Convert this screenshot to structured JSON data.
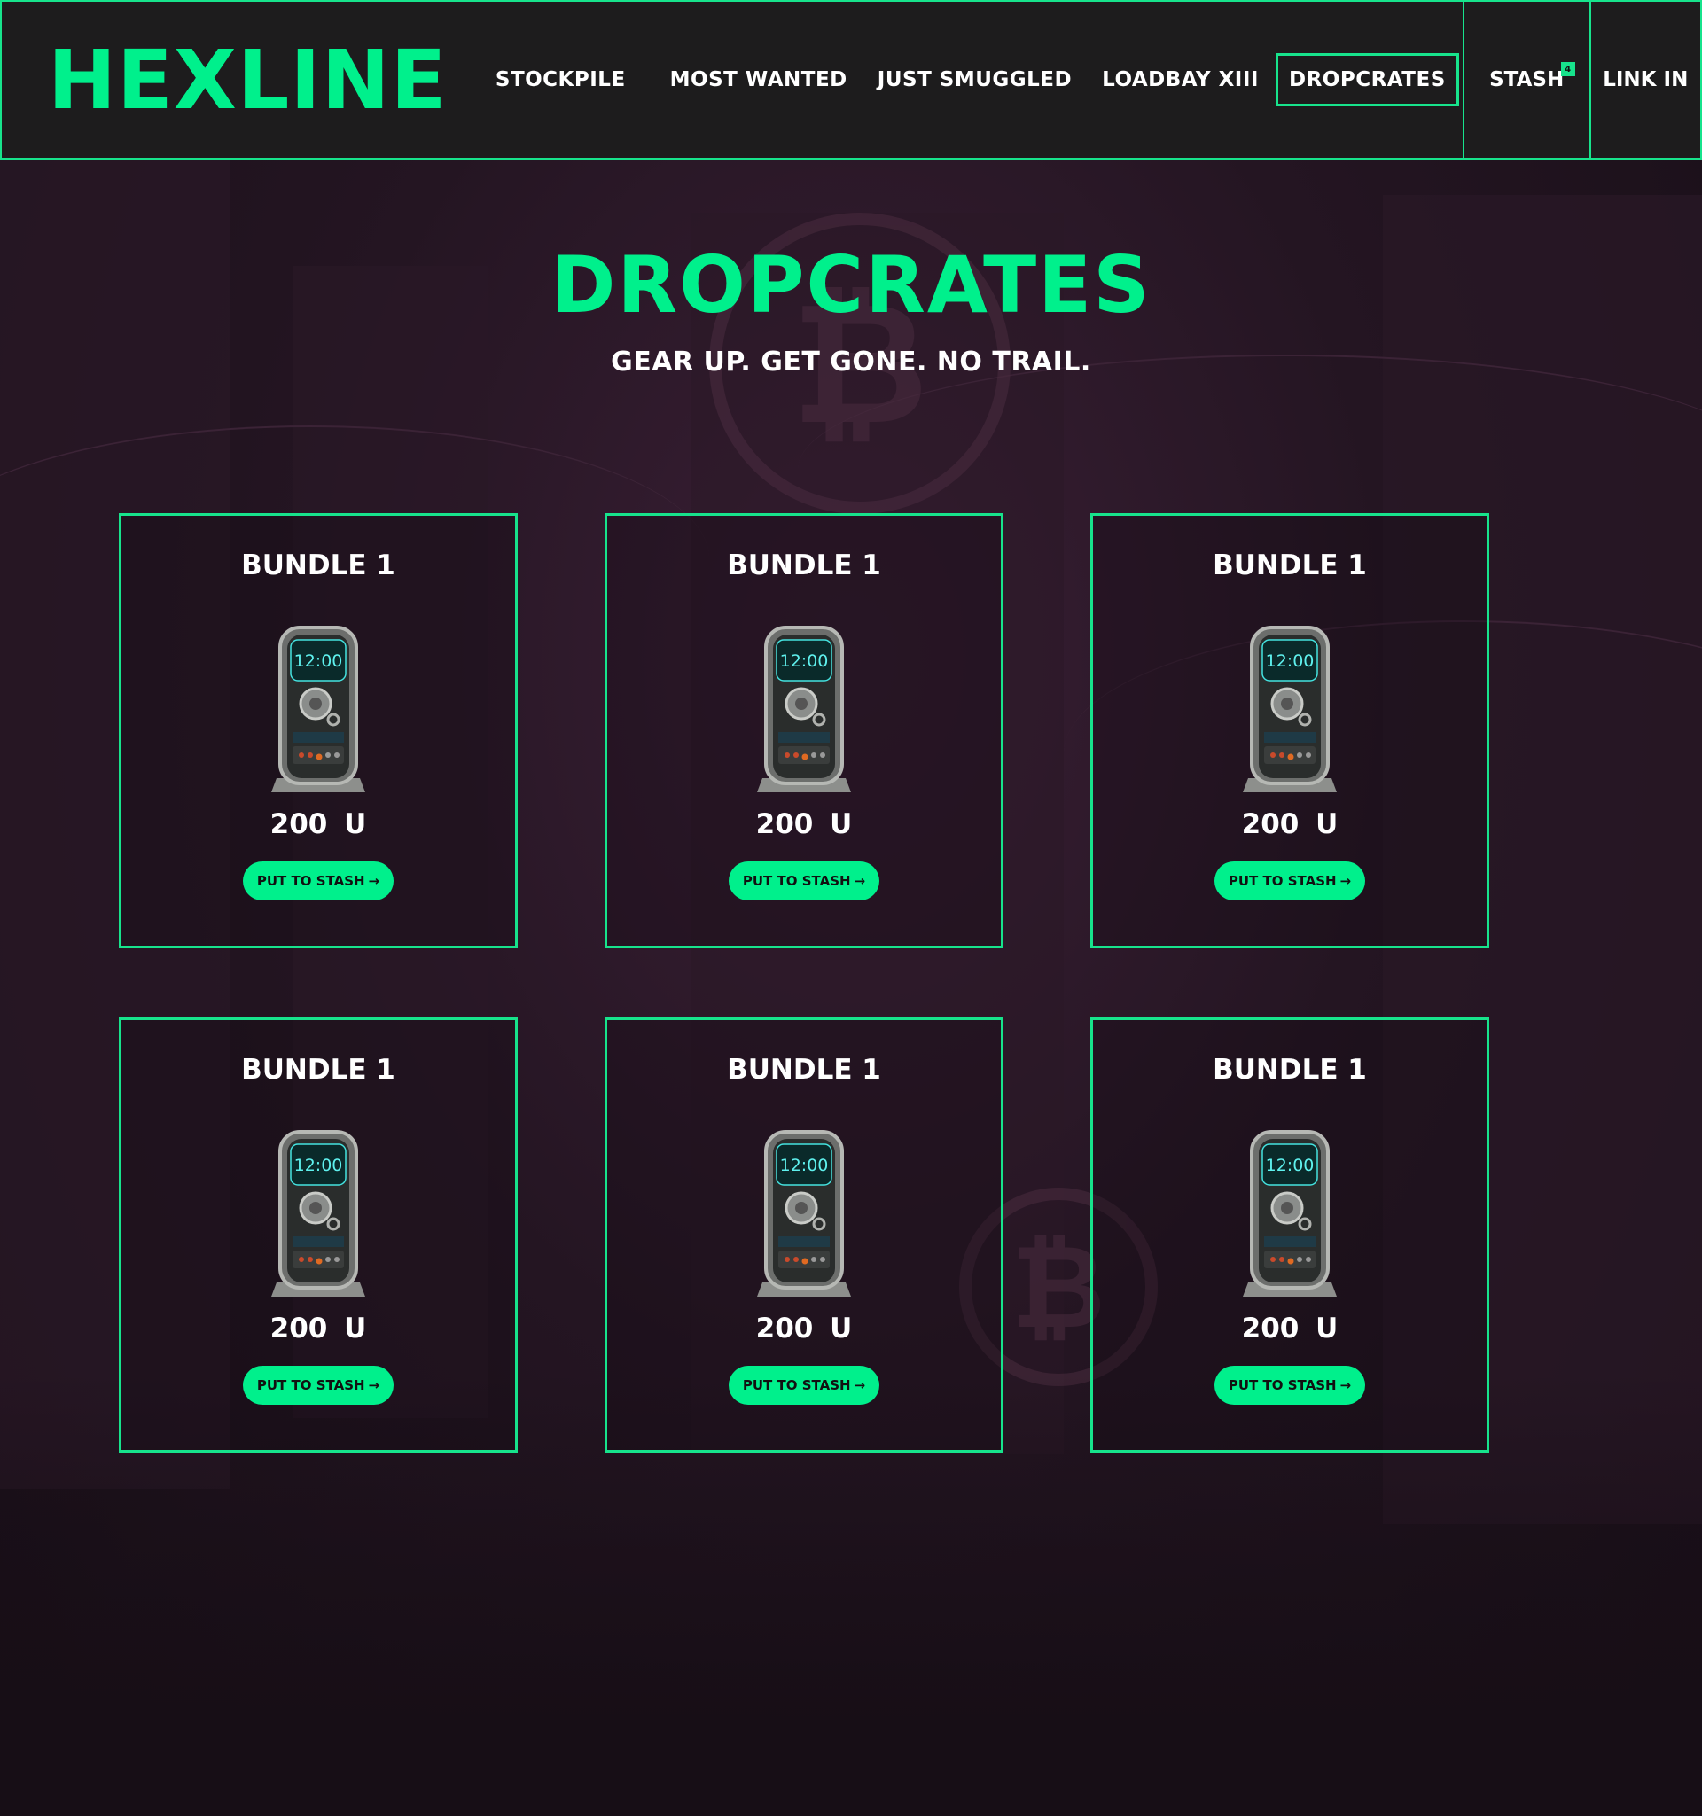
{
  "brand": {
    "logo": "HEXLINE",
    "accent": "#00f08c"
  },
  "nav": [
    {
      "label": "STOCKPILE",
      "active": false
    },
    {
      "label": "MOST WANTED",
      "active": false
    },
    {
      "label": "JUST SMUGGLED",
      "active": false
    },
    {
      "label": "LOADBAY XIII",
      "active": false
    },
    {
      "label": "DROPCRATES",
      "active": true
    }
  ],
  "header": {
    "stash_label": "STASH",
    "stash_count": "4",
    "login_label": "LINK IN"
  },
  "hero": {
    "title": "DROPCRATES",
    "subtitle": "GEAR UP. GET GONE. NO TRAIL."
  },
  "bundles": [
    {
      "title": "BUNDLE 1",
      "display": "12:00",
      "price": "200 U",
      "button": "PUT TO STASH",
      "arrow": "→"
    },
    {
      "title": "BUNDLE 1",
      "display": "12:00",
      "price": "200 U",
      "button": "PUT TO STASH",
      "arrow": "→"
    },
    {
      "title": "BUNDLE 1",
      "display": "12:00",
      "price": "200 U",
      "button": "PUT TO STASH",
      "arrow": "→"
    },
    {
      "title": "BUNDLE 1",
      "display": "12:00",
      "price": "200 U",
      "button": "PUT TO STASH",
      "arrow": "→"
    },
    {
      "title": "BUNDLE 1",
      "display": "12:00",
      "price": "200 U",
      "button": "PUT TO STASH",
      "arrow": "→"
    },
    {
      "title": "BUNDLE 1",
      "display": "12:00",
      "price": "200 U",
      "button": "PUT TO STASH",
      "arrow": "→"
    }
  ]
}
